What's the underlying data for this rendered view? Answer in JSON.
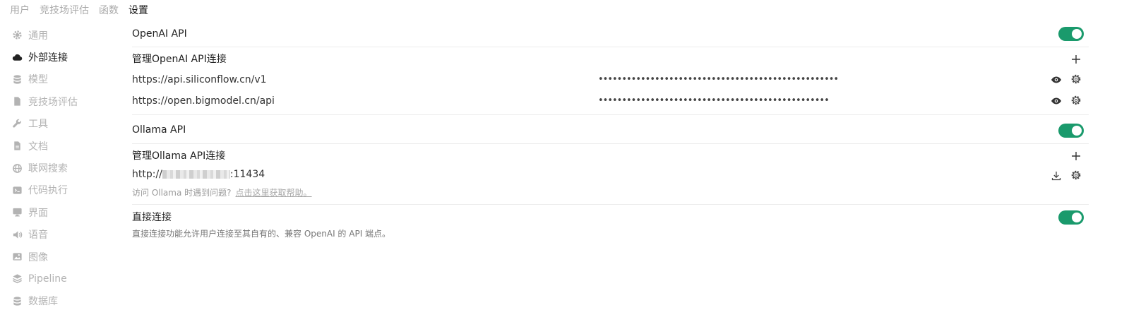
{
  "top_tabs": [
    "用户",
    "竞技场评估",
    "函数",
    "设置"
  ],
  "active_tab": "设置",
  "sidebar": {
    "items": [
      {
        "label": "通用",
        "icon": "gear-icon"
      },
      {
        "label": "外部连接",
        "icon": "cloud-icon"
      },
      {
        "label": "模型",
        "icon": "database-icon"
      },
      {
        "label": "竞技场评估",
        "icon": "document-icon"
      },
      {
        "label": "工具",
        "icon": "wrench-icon"
      },
      {
        "label": "文档",
        "icon": "file-icon"
      },
      {
        "label": "联网搜索",
        "icon": "globe-icon"
      },
      {
        "label": "代码执行",
        "icon": "terminal-icon"
      },
      {
        "label": "界面",
        "icon": "monitor-icon"
      },
      {
        "label": "语音",
        "icon": "speaker-icon"
      },
      {
        "label": "图像",
        "icon": "image-icon"
      },
      {
        "label": "Pipeline",
        "icon": "layers-icon"
      },
      {
        "label": "数据库",
        "icon": "database-icon"
      }
    ],
    "active": "外部连接"
  },
  "openai": {
    "title": "OpenAI API",
    "enabled": true,
    "manage_label": "管理OpenAI API连接",
    "connections": [
      {
        "url": "https://api.siliconflow.cn/v1",
        "key_masked": "•••••••••••••••••••••••••••••••••••••••••••••••••••"
      },
      {
        "url": "https://open.bigmodel.cn/api",
        "key_masked": "•••••••••••••••••••••••••••••••••••••••••••••••••"
      }
    ]
  },
  "ollama": {
    "title": "Ollama API",
    "enabled": true,
    "manage_label": "管理Ollama API连接",
    "url_prefix": "http://",
    "url_suffix": ":11434",
    "hint_text": "访问 Ollama 时遇到问题?",
    "hint_link": "点击这里获取帮助。"
  },
  "direct": {
    "title": "直接连接",
    "enabled": true,
    "description": "直接连接功能允许用户连接至其自有的、兼容 OpenAI 的 API 端点。"
  },
  "colors": {
    "toggle_on": "#1a9a6c",
    "sidebar_inactive": "#b3b3b3",
    "tab_inactive": "#a9a9a9"
  }
}
